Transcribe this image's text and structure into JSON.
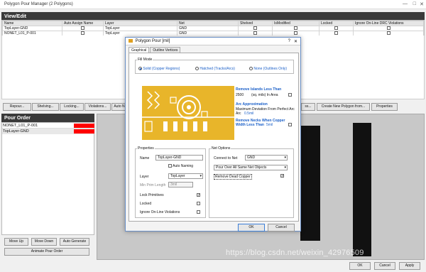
{
  "window": {
    "title": "Polygon Pour Manager (2 Polygons)"
  },
  "view_edit": {
    "header": "View/Edit",
    "columns": [
      "Name",
      "Auto Assign Name",
      "Layer",
      "Net",
      "Shelved",
      "IsModified",
      "Locked",
      "Ignore On-Line DRC Violations"
    ],
    "rows": [
      {
        "name": "TopLayer-GND",
        "layer": "TopLayer",
        "net": "GND"
      },
      {
        "name": "NONET_L01_P-001",
        "layer": "TopLayer",
        "net": "GND"
      }
    ]
  },
  "toolbar": {
    "repour": "Repour...",
    "shelving": "Shelving...",
    "locking": "Locking...",
    "violations": "Violations...",
    "auto": "Auto N",
    "create_new": "Create New Polygon from...",
    "properties": "Properties",
    "ss": "ss..."
  },
  "pour_order": {
    "header": "Pour Order",
    "items": [
      {
        "label": "NONET_L01_P-001",
        "color": "#ff0000"
      },
      {
        "label": "TopLayer-GND",
        "color": "#ff0000"
      }
    ],
    "move_up": "Move Up",
    "move_down": "Move Down",
    "auto_generate": "Auto Generate",
    "animate": "Animate Pour Order"
  },
  "dialog": {
    "title": "Polygon Pour [mil]",
    "tabs": [
      "Graphical",
      "Outline Vertices"
    ],
    "fill_mode": {
      "label": "Fill Mode",
      "options": [
        "Solid (Copper Regions)",
        "Hatched (Tracks/Arcs)",
        "None (Outlines Only)"
      ],
      "selected": 0
    },
    "remove_islands": {
      "label": "Remove Islands Less Than",
      "value": "2500",
      "unit": "(sq. mils) In Area"
    },
    "arc_approx": {
      "label": "Arc Approximation",
      "sub": "Maximum Deviation From Perfect Arc",
      "value": "0.5mil"
    },
    "remove_necks": {
      "label": "Remove Necks When Copper Width Less Than",
      "value": "5mil"
    },
    "properties": {
      "header": "Properties",
      "name_label": "Name",
      "name_value": "TopLayer-GND",
      "auto_naming": "Auto Naming",
      "layer_label": "Layer",
      "layer_value": "TopLayer",
      "min_prim_label": "Min Prim Length",
      "min_prim_value": "3mil",
      "lock_primitives": "Lock Primitives",
      "locked": "Locked",
      "ignore_online": "Ignore On-Line Violations"
    },
    "net_options": {
      "header": "Net Options",
      "connect_label": "Connect to Net",
      "connect_value": "GND",
      "pour_over": "Pour Over All Same Net Objects",
      "remove_dead": "Remove Dead Copper"
    },
    "ok": "OK",
    "cancel": "Cancel"
  },
  "footer": {
    "ok": "OK",
    "cancel": "Cancel",
    "apply": "Apply"
  },
  "watermark": "https://blog.csdn.net/weixin_42976509"
}
